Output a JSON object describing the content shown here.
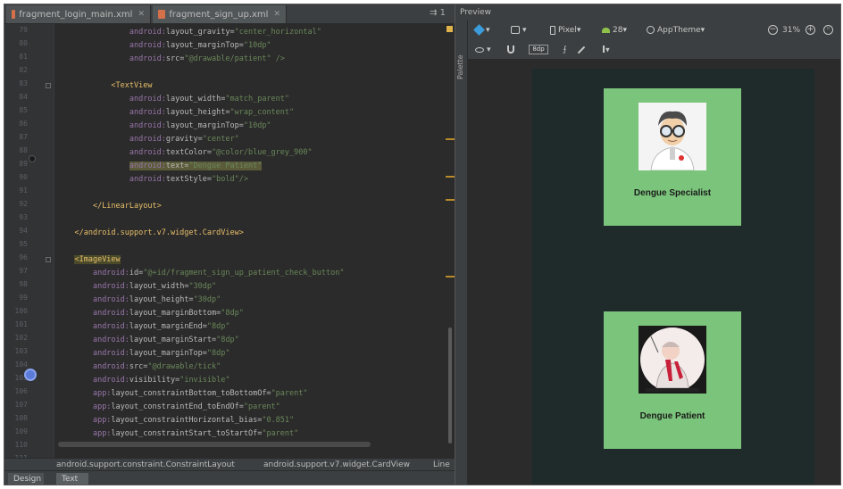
{
  "editor": {
    "tabs": [
      {
        "label": "fragment_login_main.xml",
        "active": false
      },
      {
        "label": "fragment_sign_up.xml",
        "active": true
      }
    ],
    "tab_overflow": "⇉ 1",
    "line_numbers": [
      "79",
      "80",
      "81",
      "82",
      "83",
      "84",
      "85",
      "86",
      "87",
      "88",
      "89",
      "90",
      "91",
      "92",
      "93",
      "94",
      "95",
      "96",
      "97",
      "98",
      "99",
      "100",
      "101",
      "102",
      "103",
      "104",
      "105",
      "106",
      "107",
      "108",
      "109",
      "110",
      "111"
    ],
    "code_lines": [
      {
        "indent": "                ",
        "ns": "android:",
        "attr": "layout_gravity=",
        "val": "\"center_horizontal\""
      },
      {
        "indent": "                ",
        "ns": "android:",
        "attr": "layout_marginTop=",
        "val": "\"10dp\""
      },
      {
        "indent": "                ",
        "ns": "android:",
        "attr": "src=",
        "val": "\"@drawable/patient\" />"
      },
      {
        "indent": "",
        "ns": "",
        "attr": "",
        "val": ""
      },
      {
        "indent": "            ",
        "tag": "<TextView"
      },
      {
        "indent": "                ",
        "ns": "android:",
        "attr": "layout_width=",
        "val": "\"match_parent\""
      },
      {
        "indent": "                ",
        "ns": "android:",
        "attr": "layout_height=",
        "val": "\"wrap_content\""
      },
      {
        "indent": "                ",
        "ns": "android:",
        "attr": "layout_marginTop=",
        "val": "\"10dp\""
      },
      {
        "indent": "                ",
        "ns": "android:",
        "attr": "gravity=",
        "val": "\"center\""
      },
      {
        "indent": "                ",
        "ns": "android:",
        "attr": "textColor=",
        "val": "\"@color/blue_grey_900\""
      },
      {
        "indent": "                ",
        "ns": "android:",
        "attr": "text=",
        "val": "\"Dengue Patient\""
      },
      {
        "indent": "                ",
        "ns": "android:",
        "attr": "textStyle=",
        "val": "\"bold\"/>"
      },
      {
        "indent": "",
        "ns": "",
        "attr": "",
        "val": ""
      },
      {
        "indent": "        ",
        "tag": "</LinearLayout>"
      },
      {
        "indent": "",
        "ns": "",
        "attr": "",
        "val": ""
      },
      {
        "indent": "    ",
        "tag": "</android.support.v7.widget.CardView>"
      },
      {
        "indent": "",
        "ns": "",
        "attr": "",
        "val": ""
      },
      {
        "indent": "    ",
        "tag": "<ImageView"
      },
      {
        "indent": "        ",
        "ns": "android:",
        "attr": "id=",
        "val": "\"@+id/fragment_sign_up_patient_check_button\""
      },
      {
        "indent": "        ",
        "ns": "android:",
        "attr": "layout_width=",
        "val": "\"30dp\""
      },
      {
        "indent": "        ",
        "ns": "android:",
        "attr": "layout_height=",
        "val": "\"30dp\""
      },
      {
        "indent": "        ",
        "ns": "android:",
        "attr": "layout_marginBottom=",
        "val": "\"8dp\""
      },
      {
        "indent": "        ",
        "ns": "android:",
        "attr": "layout_marginEnd=",
        "val": "\"8dp\""
      },
      {
        "indent": "        ",
        "ns": "android:",
        "attr": "layout_marginStart=",
        "val": "\"8dp\""
      },
      {
        "indent": "        ",
        "ns": "android:",
        "attr": "layout_marginTop=",
        "val": "\"8dp\""
      },
      {
        "indent": "        ",
        "ns": "android:",
        "attr": "src=",
        "val": "\"@drawable/tick\""
      },
      {
        "indent": "        ",
        "ns": "android:",
        "attr": "visibility=",
        "val": "\"invisible\""
      },
      {
        "indent": "        ",
        "ns": "app:",
        "attr": "layout_constraintBottom_toBottomOf=",
        "val": "\"parent\""
      },
      {
        "indent": "        ",
        "ns": "app:",
        "attr": "layout_constraintEnd_toEndOf=",
        "val": "\"parent\""
      },
      {
        "indent": "        ",
        "ns": "app:",
        "attr": "layout_constraintHorizontal_bias=",
        "val": "\"0.851\""
      },
      {
        "indent": "        ",
        "ns": "app:",
        "attr": "layout_constraintStart_toStartOf=",
        "val": "\"parent\""
      }
    ],
    "breadcrumb": [
      "android.support.constraint.ConstraintLayout",
      "android.support.v7.widget.CardView",
      "Line"
    ],
    "bottom_tabs": {
      "design": "Design",
      "text": "Text"
    }
  },
  "preview": {
    "header": "Preview",
    "side_label": "Palette",
    "toolbar1": {
      "device": "Pixel▾",
      "api": "28▾",
      "theme": "AppTheme▾",
      "zoom": "31%"
    },
    "toolbar2": {
      "margin": "8dp"
    },
    "cards": [
      {
        "label": "Dengue Specialist",
        "image": "doctor-avatar"
      },
      {
        "label": "Dengue Patient",
        "image": "patient-avatar"
      }
    ],
    "colors": {
      "card_bg": "#7bc47b",
      "device_bg": "#1f2a2b"
    }
  }
}
